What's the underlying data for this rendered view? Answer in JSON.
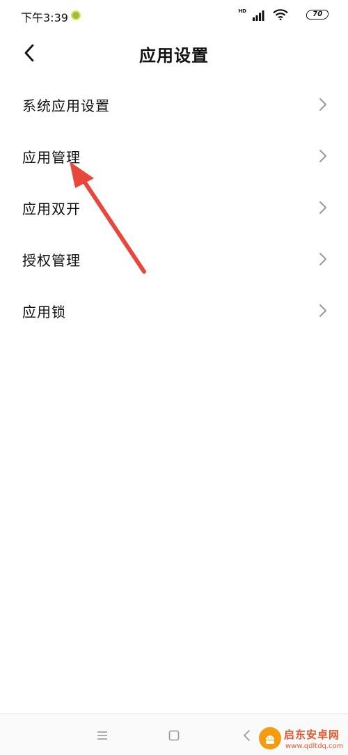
{
  "status_bar": {
    "time": "下午3:39",
    "network_badge": "HD",
    "battery_level": "70",
    "icons": [
      "app-notification-icon",
      "signal-icon",
      "wifi-icon",
      "battery-icon"
    ]
  },
  "header": {
    "title": "应用设置",
    "back_icon": "chevron-left-icon"
  },
  "settings": {
    "items": [
      {
        "label": "系统应用设置"
      },
      {
        "label": "应用管理"
      },
      {
        "label": "应用双开"
      },
      {
        "label": "授权管理"
      },
      {
        "label": "应用锁"
      }
    ]
  },
  "annotation": {
    "arrow_color": "#e8473c",
    "points_to": "应用管理"
  },
  "nav_bar": {
    "icons": [
      "menu-icon",
      "home-icon",
      "back-icon"
    ]
  },
  "watermark": {
    "title": "启东安卓网",
    "url": "www.qdltdq.com"
  },
  "colors": {
    "text": "#111111",
    "chevron": "#999999",
    "background": "#ffffff"
  }
}
